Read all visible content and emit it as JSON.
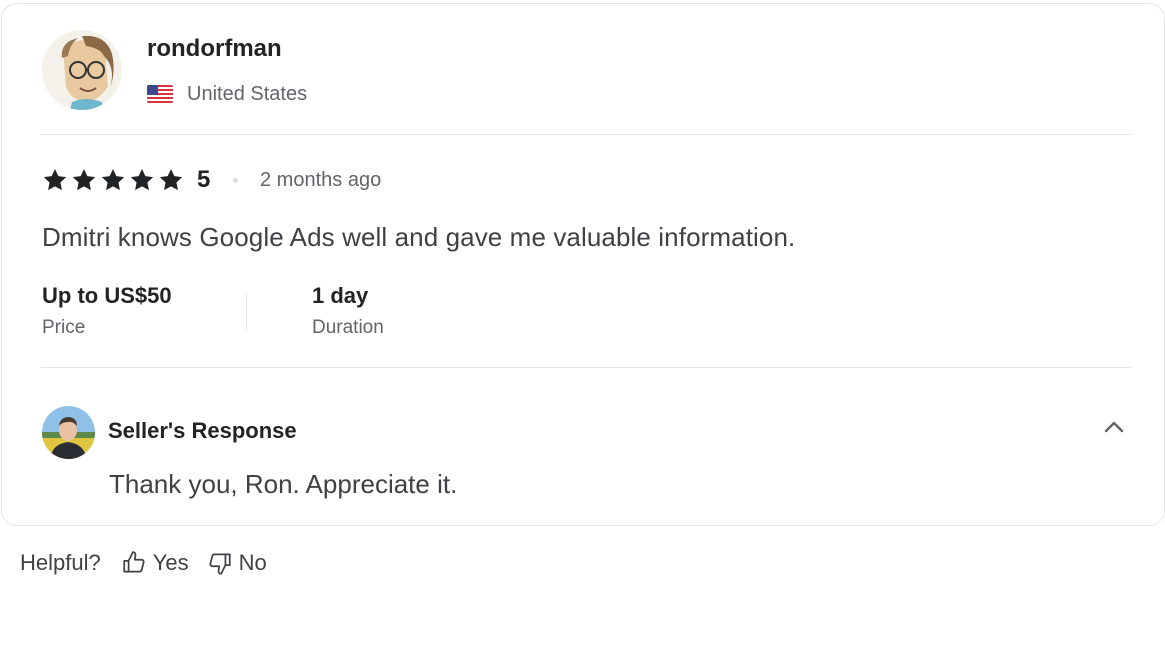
{
  "review": {
    "username": "rondorfman",
    "country": "United States",
    "flag_icon": "us-flag-icon",
    "rating": "5",
    "stars": 5,
    "time_ago": "2 months ago",
    "text": "Dmitri knows Google Ads well and gave me valuable information.",
    "price": {
      "value": "Up to US$50",
      "label": "Price"
    },
    "duration": {
      "value": "1 day",
      "label": "Duration"
    }
  },
  "seller_response": {
    "title": "Seller's Response",
    "text": "Thank you, Ron. Appreciate it.",
    "toggle_icon": "chevron-up-icon"
  },
  "helpful": {
    "label": "Helpful?",
    "yes_label": "Yes",
    "no_label": "No",
    "yes_icon": "thumbs-up-icon",
    "no_icon": "thumbs-down-icon"
  },
  "colors": {
    "text_primary": "#222325",
    "text_secondary": "#62646a",
    "border": "#e4e5e7"
  }
}
